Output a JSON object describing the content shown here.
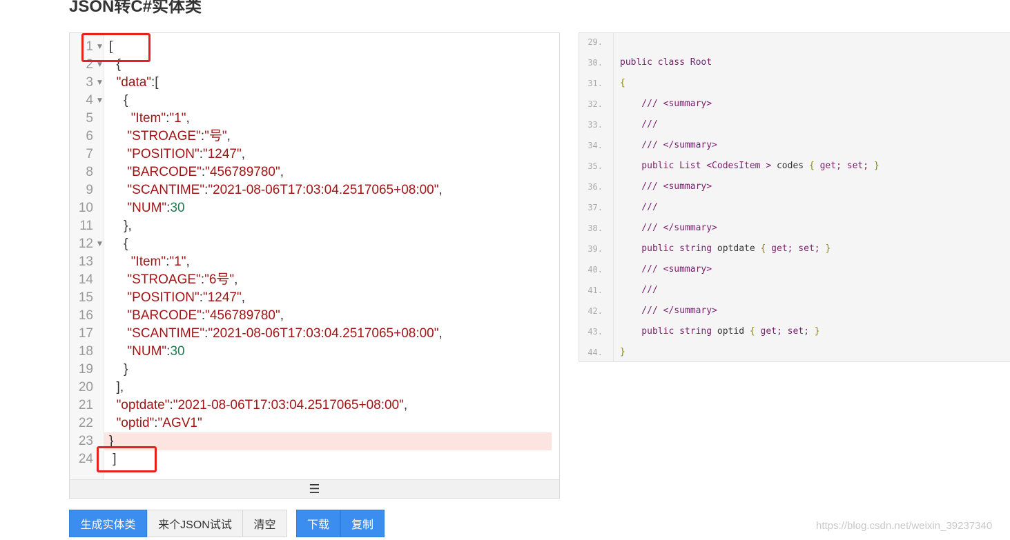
{
  "page": {
    "title": "JSON转C#实体类"
  },
  "editor": {
    "footer_icon": "hamburger-icon",
    "lines": [
      {
        "n": "1",
        "fold": true,
        "segs": [
          {
            "t": "["
          }
        ]
      },
      {
        "n": "2",
        "fold": true,
        "segs": [
          {
            "t": "  {"
          }
        ]
      },
      {
        "n": "3",
        "fold": true,
        "segs": [
          {
            "t": "  "
          },
          {
            "t": "\"data\"",
            "c": "str"
          },
          {
            "t": ":["
          }
        ]
      },
      {
        "n": "4",
        "fold": true,
        "segs": [
          {
            "t": "    {"
          }
        ]
      },
      {
        "n": "5",
        "fold": false,
        "segs": [
          {
            "t": "      "
          },
          {
            "t": "\"Item\"",
            "c": "str"
          },
          {
            "t": ":"
          },
          {
            "t": "\"1\"",
            "c": "str"
          },
          {
            "t": ","
          }
        ]
      },
      {
        "n": "6",
        "fold": false,
        "segs": [
          {
            "t": "     "
          },
          {
            "t": "\"STROAGE\"",
            "c": "str"
          },
          {
            "t": ":"
          },
          {
            "t": "\"号\"",
            "c": "str"
          },
          {
            "t": ","
          }
        ]
      },
      {
        "n": "7",
        "fold": false,
        "segs": [
          {
            "t": "     "
          },
          {
            "t": "\"POSITION\"",
            "c": "str"
          },
          {
            "t": ":"
          },
          {
            "t": "\"1247\"",
            "c": "str"
          },
          {
            "t": ","
          }
        ]
      },
      {
        "n": "8",
        "fold": false,
        "segs": [
          {
            "t": "     "
          },
          {
            "t": "\"BARCODE\"",
            "c": "str"
          },
          {
            "t": ":"
          },
          {
            "t": "\"456789780\"",
            "c": "str"
          },
          {
            "t": ","
          }
        ]
      },
      {
        "n": "9",
        "fold": false,
        "segs": [
          {
            "t": "     "
          },
          {
            "t": "\"SCANTIME\"",
            "c": "str"
          },
          {
            "t": ":"
          },
          {
            "t": "\"2021-08-06T17:03:04.2517065+08:00\"",
            "c": "str"
          },
          {
            "t": ","
          }
        ]
      },
      {
        "n": "10",
        "fold": false,
        "segs": [
          {
            "t": "     "
          },
          {
            "t": "\"NUM\"",
            "c": "str"
          },
          {
            "t": ":"
          },
          {
            "t": "30",
            "c": "num"
          }
        ]
      },
      {
        "n": "11",
        "fold": false,
        "segs": [
          {
            "t": "    },"
          }
        ]
      },
      {
        "n": "12",
        "fold": true,
        "segs": [
          {
            "t": "    {"
          }
        ]
      },
      {
        "n": "13",
        "fold": false,
        "segs": [
          {
            "t": "      "
          },
          {
            "t": "\"Item\"",
            "c": "str"
          },
          {
            "t": ":"
          },
          {
            "t": "\"1\"",
            "c": "str"
          },
          {
            "t": ","
          }
        ]
      },
      {
        "n": "14",
        "fold": false,
        "segs": [
          {
            "t": "     "
          },
          {
            "t": "\"STROAGE\"",
            "c": "str"
          },
          {
            "t": ":"
          },
          {
            "t": "\"6号\"",
            "c": "str"
          },
          {
            "t": ","
          }
        ]
      },
      {
        "n": "15",
        "fold": false,
        "segs": [
          {
            "t": "     "
          },
          {
            "t": "\"POSITION\"",
            "c": "str"
          },
          {
            "t": ":"
          },
          {
            "t": "\"1247\"",
            "c": "str"
          },
          {
            "t": ","
          }
        ]
      },
      {
        "n": "16",
        "fold": false,
        "segs": [
          {
            "t": "     "
          },
          {
            "t": "\"BARCODE\"",
            "c": "str"
          },
          {
            "t": ":"
          },
          {
            "t": "\"456789780\"",
            "c": "str"
          },
          {
            "t": ","
          }
        ]
      },
      {
        "n": "17",
        "fold": false,
        "segs": [
          {
            "t": "     "
          },
          {
            "t": "\"SCANTIME\"",
            "c": "str"
          },
          {
            "t": ":"
          },
          {
            "t": "\"2021-08-06T17:03:04.2517065+08:00\"",
            "c": "str"
          },
          {
            "t": ","
          }
        ]
      },
      {
        "n": "18",
        "fold": false,
        "segs": [
          {
            "t": "     "
          },
          {
            "t": "\"NUM\"",
            "c": "str"
          },
          {
            "t": ":"
          },
          {
            "t": "30",
            "c": "num"
          }
        ]
      },
      {
        "n": "19",
        "fold": false,
        "segs": [
          {
            "t": "    }"
          }
        ]
      },
      {
        "n": "20",
        "fold": false,
        "segs": [
          {
            "t": "  ],"
          }
        ]
      },
      {
        "n": "21",
        "fold": false,
        "segs": [
          {
            "t": "  "
          },
          {
            "t": "\"optdate\"",
            "c": "str"
          },
          {
            "t": ":"
          },
          {
            "t": "\"2021-08-06T17:03:04.2517065+08:00\"",
            "c": "str"
          },
          {
            "t": ","
          }
        ]
      },
      {
        "n": "22",
        "fold": false,
        "segs": [
          {
            "t": "  "
          },
          {
            "t": "\"optid\"",
            "c": "str"
          },
          {
            "t": ":"
          },
          {
            "t": "\"AGV1\"",
            "c": "str"
          }
        ]
      },
      {
        "n": "23",
        "fold": false,
        "highlight": true,
        "segs": [
          {
            "t": "}"
          }
        ]
      },
      {
        "n": "24",
        "fold": false,
        "segs": [
          {
            "t": " ]"
          }
        ]
      }
    ]
  },
  "output": {
    "lines": [
      {
        "n": "29.",
        "segs": []
      },
      {
        "n": "30.",
        "segs": [
          {
            "t": "public class ",
            "c": "kw"
          },
          {
            "t": "Root",
            "c": "kw"
          }
        ]
      },
      {
        "n": "31.",
        "segs": [
          {
            "t": "{",
            "c": "br"
          }
        ]
      },
      {
        "n": "32.",
        "segs": [
          {
            "t": "    /// <summary>",
            "c": "cm"
          }
        ]
      },
      {
        "n": "33.",
        "segs": [
          {
            "t": "    ///",
            "c": "cm"
          }
        ]
      },
      {
        "n": "34.",
        "segs": [
          {
            "t": "    /// </summary>",
            "c": "cm"
          }
        ]
      },
      {
        "n": "35.",
        "segs": [
          {
            "t": "    public List <CodesItem > ",
            "c": "kw"
          },
          {
            "t": "codes "
          },
          {
            "t": "{ ",
            "c": "br"
          },
          {
            "t": "get; set; ",
            "c": "kw"
          },
          {
            "t": "}",
            "c": "br"
          }
        ]
      },
      {
        "n": "36.",
        "segs": [
          {
            "t": "    /// <summary>",
            "c": "cm"
          }
        ]
      },
      {
        "n": "37.",
        "segs": [
          {
            "t": "    ///",
            "c": "cm"
          }
        ]
      },
      {
        "n": "38.",
        "segs": [
          {
            "t": "    /// </summary>",
            "c": "cm"
          }
        ]
      },
      {
        "n": "39.",
        "segs": [
          {
            "t": "    public string ",
            "c": "kw"
          },
          {
            "t": "optdate "
          },
          {
            "t": "{ ",
            "c": "br"
          },
          {
            "t": "get; set; ",
            "c": "kw"
          },
          {
            "t": "}",
            "c": "br"
          }
        ]
      },
      {
        "n": "40.",
        "segs": [
          {
            "t": "    /// <summary>",
            "c": "cm"
          }
        ]
      },
      {
        "n": "41.",
        "segs": [
          {
            "t": "    ///",
            "c": "cm"
          }
        ]
      },
      {
        "n": "42.",
        "segs": [
          {
            "t": "    /// </summary>",
            "c": "cm"
          }
        ]
      },
      {
        "n": "43.",
        "segs": [
          {
            "t": "    public string ",
            "c": "kw"
          },
          {
            "t": "optid "
          },
          {
            "t": "{ ",
            "c": "br"
          },
          {
            "t": "get; set; ",
            "c": "kw"
          },
          {
            "t": "}",
            "c": "br"
          }
        ]
      },
      {
        "n": "44.",
        "segs": [
          {
            "t": "}",
            "c": "br"
          }
        ]
      }
    ]
  },
  "buttons": {
    "generate": "生成实体类",
    "sample": "来个JSON试试",
    "clear": "清空",
    "download": "下载",
    "copy": "复制"
  },
  "watermark": "https://blog.csdn.net/weixin_39237340",
  "colors": {
    "primary": "#3b8ef0",
    "annotation_red": "#e8201d",
    "highlight_line": "#fce5e1"
  }
}
